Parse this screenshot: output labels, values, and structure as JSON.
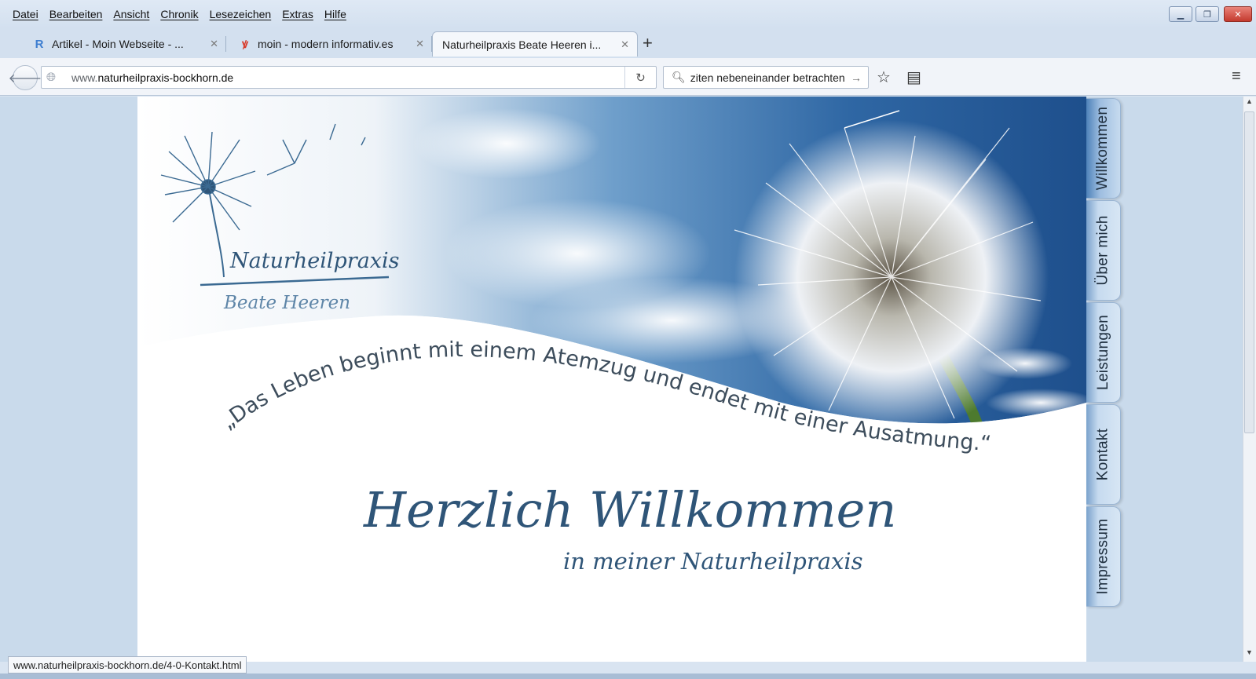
{
  "menu": [
    "Datei",
    "Bearbeiten",
    "Ansicht",
    "Chronik",
    "Lesezeichen",
    "Extras",
    "Hilfe"
  ],
  "tabs": [
    {
      "title": "Artikel - Moin Webseite - ...",
      "icon": "r-logo-icon",
      "state": "inactive"
    },
    {
      "title": "moin - modern informativ.es",
      "icon": "moin-logo-icon",
      "state": "inactive"
    },
    {
      "title": "Naturheilpraxis Beate Heeren i...",
      "icon": "",
      "state": "active"
    }
  ],
  "newtab_label": "+",
  "address": {
    "prefix": "www.",
    "domain": "naturheilpraxis-bockhorn.de"
  },
  "search": {
    "value": "ziten nebeneinander betrachten"
  },
  "site": {
    "logo_title": "Naturheilpraxis",
    "logo_subtitle": "Beate Heeren",
    "quote": "„Das Leben beginnt mit einem Atemzug und endet mit einer Ausatmung.“",
    "welcome": "Herzlich Willkommen",
    "welcome_sub": "in meiner Naturheilpraxis",
    "nav": [
      "Willkommen",
      "Über mich",
      "Leistungen",
      "Kontakt",
      "Impressum"
    ],
    "colors": {
      "accent": "#2f5578",
      "sky": "#3c6fa5"
    }
  },
  "status_url": "www.naturheilpraxis-bockhorn.de/4-0-Kontakt.html"
}
